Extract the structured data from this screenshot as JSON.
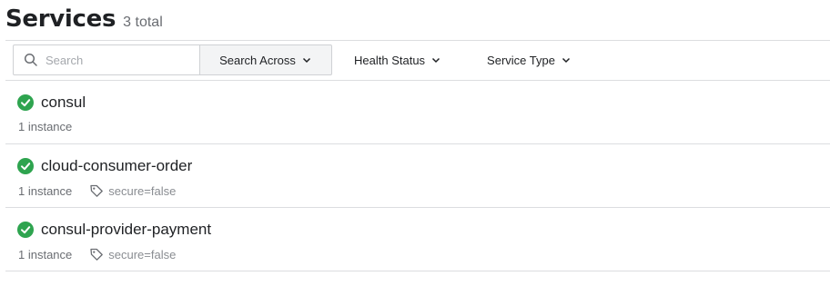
{
  "header": {
    "title": "Services",
    "count": "3 total"
  },
  "filters": {
    "search_placeholder": "Search",
    "search_across_label": "Search Across",
    "health_status_label": "Health Status",
    "service_type_label": "Service Type"
  },
  "colors": {
    "passing_green": "#2ea44f",
    "border": "#dcdde0",
    "muted_text": "#6a6d72"
  },
  "services": [
    {
      "name": "consul",
      "instances": "1 instance",
      "tag": "",
      "status": "passing"
    },
    {
      "name": "cloud-consumer-order",
      "instances": "1 instance",
      "tag": "secure=false",
      "status": "passing"
    },
    {
      "name": "consul-provider-payment",
      "instances": "1 instance",
      "tag": "secure=false",
      "status": "passing"
    }
  ]
}
